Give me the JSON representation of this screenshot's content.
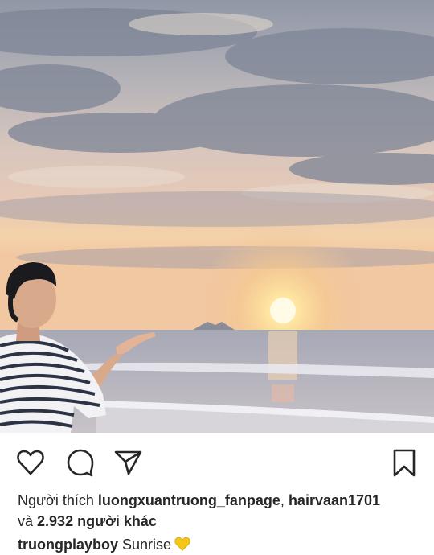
{
  "post": {
    "image_description_icon": "sunrise-beach-photo",
    "actions": {
      "like_icon": "heart-icon",
      "comment_icon": "comment-bubble-icon",
      "share_icon": "send-icon",
      "save_icon": "bookmark-icon"
    },
    "likes": {
      "prefix": "Người thích",
      "user1": "luongxuantruong_fanpage",
      "separator": ",",
      "user2": "hairvaan1701",
      "connector": "và",
      "others": "2.932 người khác"
    },
    "caption": {
      "username": "truongplayboy",
      "text": "Sunrise",
      "emoji_icon": "yellow-heart-icon"
    }
  },
  "colors": {
    "text": "#262626",
    "emoji": "#f5c518"
  }
}
